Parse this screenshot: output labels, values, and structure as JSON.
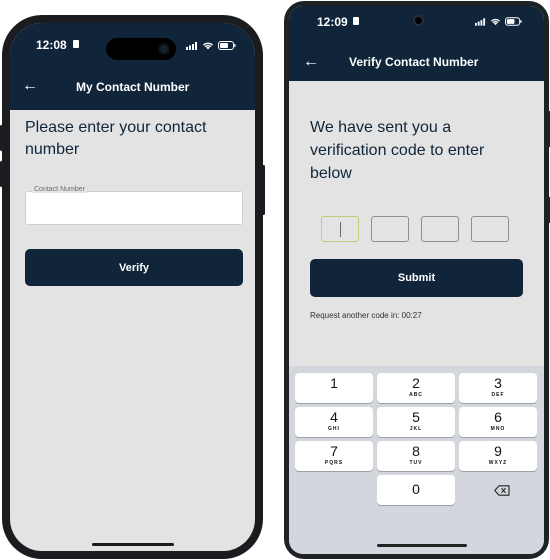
{
  "phone1": {
    "status_time": "12:08",
    "title": "My Contact Number",
    "heading": "Please enter your contact number",
    "input_label": "Contact Number",
    "input_value": "",
    "button_label": "Verify"
  },
  "phone2": {
    "status_time": "12:09",
    "title": "Verify Contact Number",
    "heading": "We have sent you a verification code to enter below",
    "button_label": "Submit",
    "resend_text": "Request another code in: 00:27",
    "keys": [
      {
        "num": "1",
        "letters": ""
      },
      {
        "num": "2",
        "letters": "ABC"
      },
      {
        "num": "3",
        "letters": "DEF"
      },
      {
        "num": "4",
        "letters": "GHI"
      },
      {
        "num": "5",
        "letters": "JKL"
      },
      {
        "num": "6",
        "letters": "MNO"
      },
      {
        "num": "7",
        "letters": "PQRS"
      },
      {
        "num": "8",
        "letters": "TUV"
      },
      {
        "num": "9",
        "letters": "WXYZ"
      },
      {
        "num": "0",
        "letters": ""
      }
    ]
  },
  "icons": {
    "back": "arrow-left-icon",
    "signal": "signal-icon",
    "wifi": "wifi-icon",
    "battery": "battery-icon",
    "backspace": "backspace-icon"
  },
  "colors": {
    "brand_navy": "#10253a",
    "screen_bg": "#e3e3e3",
    "otp_active": "#b7d27a"
  }
}
